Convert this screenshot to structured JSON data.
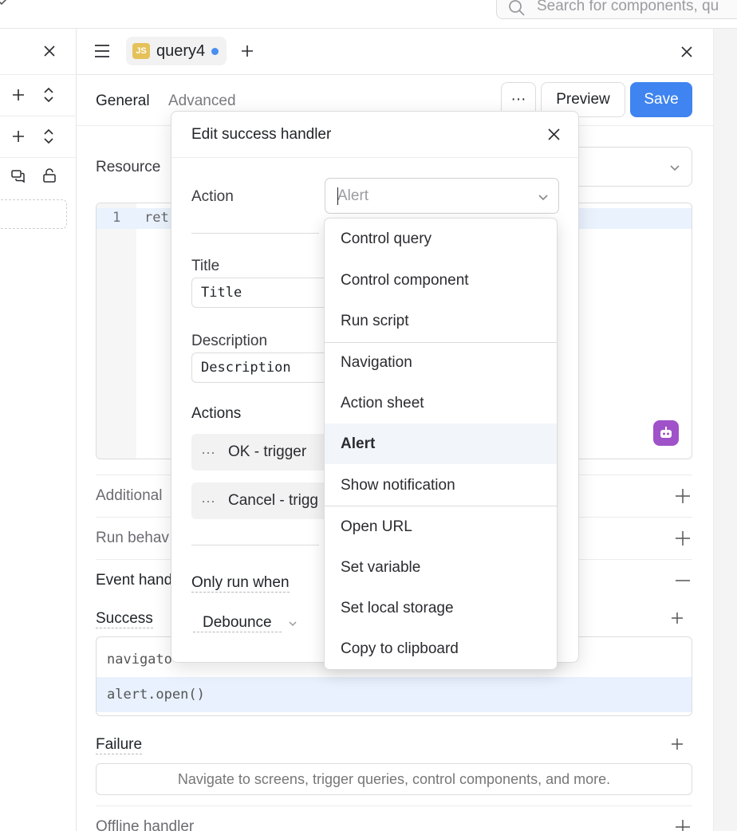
{
  "topbar": {
    "search_placeholder": "Search for components, qu"
  },
  "query": {
    "name": "query4",
    "badge": "JS"
  },
  "tabs": {
    "general": "General",
    "advanced": "Advanced"
  },
  "toolbar": {
    "more_label": "···",
    "preview_label": "Preview",
    "save_label": "Save"
  },
  "editor": {
    "resource_label": "Resource",
    "line_number": "1",
    "code_snippet": "ret"
  },
  "sections": {
    "additional": "Additional",
    "run_behavior": "Run behav",
    "event_handlers": "Event hand",
    "success": "Success",
    "failure": "Failure",
    "offline_handler": "Offline handler"
  },
  "success_handlers": [
    {
      "code": "navigato"
    },
    {
      "code": "alert.open()"
    }
  ],
  "failure_placeholder": "Navigate to screens, trigger queries, control components, and more.",
  "dialog": {
    "title": "Edit success handler",
    "action_label": "Action",
    "action_placeholder": "Alert",
    "title_label": "Title",
    "title_value": "Title",
    "description_label": "Description",
    "description_value": "Description",
    "actions_label": "Actions",
    "actions": [
      {
        "label": "OK - trigger"
      },
      {
        "label": "Cancel - trigg"
      }
    ],
    "only_run_when": "Only run when",
    "debounce": "Debounce"
  },
  "menu": {
    "items": [
      {
        "label": "Control query"
      },
      {
        "label": "Control component"
      },
      {
        "label": "Run script"
      },
      {
        "label": "Navigation"
      },
      {
        "label": "Action sheet"
      },
      {
        "label": "Alert"
      },
      {
        "label": "Show notification"
      },
      {
        "label": "Open URL"
      },
      {
        "label": "Set variable"
      },
      {
        "label": "Set local storage"
      },
      {
        "label": "Copy to clipboard"
      }
    ],
    "active_item": "Alert"
  },
  "colors": {
    "accent": "#3f84f0",
    "dirty_dot": "#4a8ff0",
    "js_badge": "#e5c15a",
    "ai_bot": "#a052c8"
  },
  "icons": [
    "chevron-down-icon",
    "search-icon",
    "close-icon",
    "plus-icon",
    "sort-chevrons-icon",
    "comments-icon",
    "lock-open-icon",
    "hamburger-menu-icon",
    "robot-icon",
    "minus-icon"
  ]
}
